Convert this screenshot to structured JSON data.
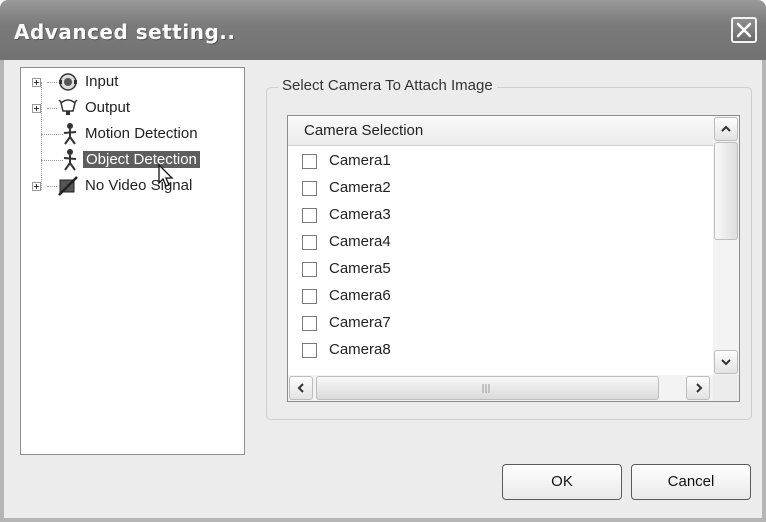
{
  "window": {
    "title": "Advanced setting..",
    "close_icon": "close-icon"
  },
  "tree": {
    "items": [
      {
        "label": "Input",
        "icon": "input-camera-icon",
        "expandable": true
      },
      {
        "label": "Output",
        "icon": "output-alarm-icon",
        "expandable": true
      },
      {
        "label": "Motion Detection",
        "icon": "motion-person-icon",
        "expandable": false
      },
      {
        "label": "Object Detection",
        "icon": "object-person-icon",
        "expandable": false,
        "selected": true
      },
      {
        "label": "No Video Signal",
        "icon": "no-video-icon",
        "expandable": true
      }
    ]
  },
  "group": {
    "title": "Select Camera To Attach Image"
  },
  "list": {
    "header": "Camera Selection",
    "rows": [
      {
        "label": "Camera1",
        "checked": false
      },
      {
        "label": "Camera2",
        "checked": false
      },
      {
        "label": "Camera3",
        "checked": false
      },
      {
        "label": "Camera4",
        "checked": false
      },
      {
        "label": "Camera5",
        "checked": false
      },
      {
        "label": "Camera6",
        "checked": false
      },
      {
        "label": "Camera7",
        "checked": false
      },
      {
        "label": "Camera8",
        "checked": false
      }
    ]
  },
  "buttons": {
    "ok": "OK",
    "cancel": "Cancel"
  },
  "colors": {
    "titlebar": "#7b7b7b",
    "selection": "#5e5e5e",
    "client": "#ececec"
  }
}
